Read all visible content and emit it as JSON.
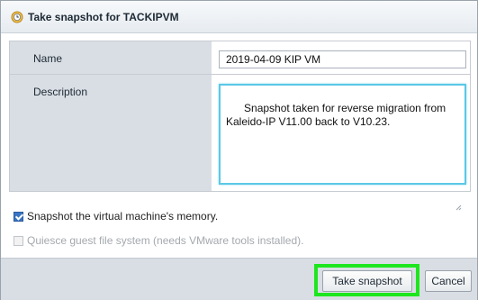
{
  "dialog": {
    "title": "Take snapshot for TACKIPVM"
  },
  "form": {
    "name_label": "Name",
    "name_value": "2019-04-09 KIP VM",
    "description_label": "Description",
    "description_value": "Snapshot taken for reverse migration from Kaleido-IP V11.00 back to V10.23."
  },
  "options": {
    "memory_label": "Snapshot the virtual machine's memory.",
    "memory_checked": true,
    "quiesce_label": "Quiesce guest file system (needs VMware tools installed).",
    "quiesce_checked": false,
    "quiesce_disabled": true
  },
  "buttons": {
    "take_snapshot": "Take snapshot",
    "cancel": "Cancel"
  },
  "colors": {
    "highlight": "#1ee61e",
    "focus_border": "#5bc8e6",
    "checkbox_accent": "#3a74c4"
  },
  "icons": {
    "title_icon": "snapshot-clock-icon"
  }
}
